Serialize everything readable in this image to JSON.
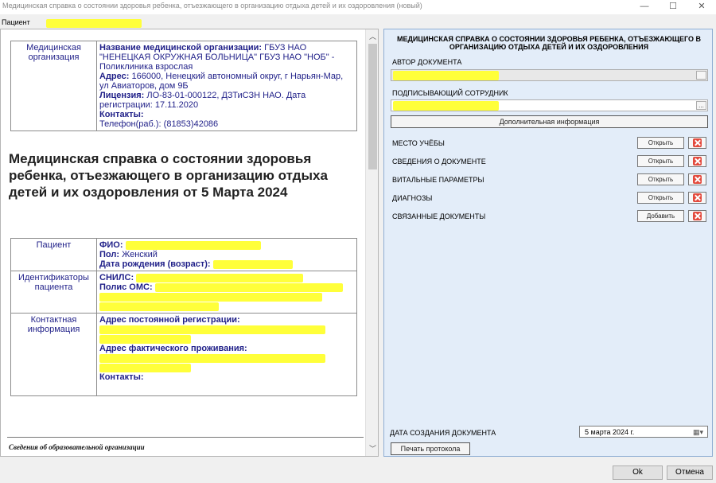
{
  "window": {
    "title": "Медицинская справка о состоянии здоровья ребенка, отъезжающего в организацию отдыха детей и их оздоровления (новый)",
    "min": "—",
    "max": "☐",
    "close": "✕"
  },
  "patient_bar": {
    "label": "Пациент"
  },
  "org_table": {
    "label": "Медицинская организация",
    "name_label": "Название медицинской организации:",
    "name_value": "ГБУЗ НАО \"НЕНЕЦКАЯ ОКРУЖНАЯ БОЛЬНИЦА\" ГБУЗ НАО \"НОБ\" - Поликлиника взрослая",
    "address_label": "Адрес:",
    "address_value": "166000, Ненецкий автономный округ, г Нарьян-Мар, ул Авиаторов, дом 9Б",
    "license_label": "Лицензия:",
    "license_value": "ЛО-83-01-000122, ДЗТиСЗН НАО. Дата регистрации: 17.11.2020",
    "contacts_label": "Контакты:",
    "contacts_value": "Телефон(раб.): (81853)42086"
  },
  "doc_heading": "Медицинская справка о состоянии здоровья ребенка, отъезжающего в организацию отдыха детей и их оздоровления от 5 Марта 2024",
  "patient_table": {
    "patient_label": "Пациент",
    "fio_label": "ФИО:",
    "sex_label": "Пол:",
    "sex_value": "Женский",
    "dob_label": "Дата рождения (возраст):",
    "ids_label": "Идентификаторы пациента",
    "snils_label": "СНИЛС:",
    "oms_label": "Полис ОМС:",
    "contact_label": "Контактная информация",
    "reg_addr_label": "Адрес постоянной регистрации:",
    "fact_addr_label": "Адрес фактического проживания:",
    "contacts_label": "Контакты:"
  },
  "footer_section": "Сведения об образовательной организации",
  "form": {
    "title": "МЕДИЦИНСКАЯ СПРАВКА О СОСТОЯНИИ ЗДОРОВЬЯ РЕБЕНКА, ОТЪЕЗЖАЮЩЕГО В ОРГАНИЗАЦИЮ ОТДЫХА ДЕТЕЙ И ИХ ОЗДОРОВЛЕНИЯ",
    "author_label": "АВТОР ДОКУМЕНТА",
    "signer_label": "ПОДПИСЫВАЮЩИЙ СОТРУДНИК",
    "browse": "...",
    "additional_info": "Дополнительная информация",
    "sections": [
      {
        "label": "МЕСТО УЧЁБЫ",
        "button": "Открыть"
      },
      {
        "label": "СВЕДЕНИЯ О ДОКУМЕНТЕ",
        "button": "Открыть"
      },
      {
        "label": "ВИТАЛЬНЫЕ ПАРАМЕТРЫ",
        "button": "Открыть"
      },
      {
        "label": "ДИАГНОЗЫ",
        "button": "Открыть"
      },
      {
        "label": "СВЯЗАННЫЕ ДОКУМЕНТЫ",
        "button": "Добавить"
      }
    ],
    "date_label": "ДАТА СОЗДАНИЯ ДОКУМЕНТА",
    "date_value": "5  марта  2024 г.",
    "calendar_glyph": "▦▾",
    "print_button": "Печать протокола"
  },
  "dialog": {
    "ok": "Ok",
    "cancel": "Отмена"
  },
  "colors": {
    "highlight": "#ffff3a",
    "form_bg": "#e3edf9",
    "delete_red": "#e34a3d",
    "doc_text": "#1f1f88"
  }
}
